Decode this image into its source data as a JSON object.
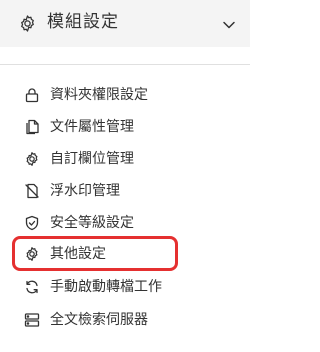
{
  "header": {
    "title": "模組設定",
    "icon": "gear-icon",
    "toggle_icon": "chevron-down-icon"
  },
  "sidebar": {
    "items": [
      {
        "label": "資料夾權限設定",
        "icon": "lock-icon"
      },
      {
        "label": "文件屬性管理",
        "icon": "documents-icon"
      },
      {
        "label": "自訂欄位管理",
        "icon": "gear-icon"
      },
      {
        "label": "浮水印管理",
        "icon": "watermark-icon"
      },
      {
        "label": "安全等級設定",
        "icon": "shield-icon"
      },
      {
        "label": "其他設定",
        "icon": "gear-icon",
        "highlighted": true
      },
      {
        "label": "手動啟動轉檔工作",
        "icon": "sync-icon"
      },
      {
        "label": "全文檢索伺服器",
        "icon": "server-icon"
      }
    ]
  },
  "colors": {
    "header_bg": "#f4f4f4",
    "text": "#333333",
    "highlight_border": "#e53030"
  }
}
